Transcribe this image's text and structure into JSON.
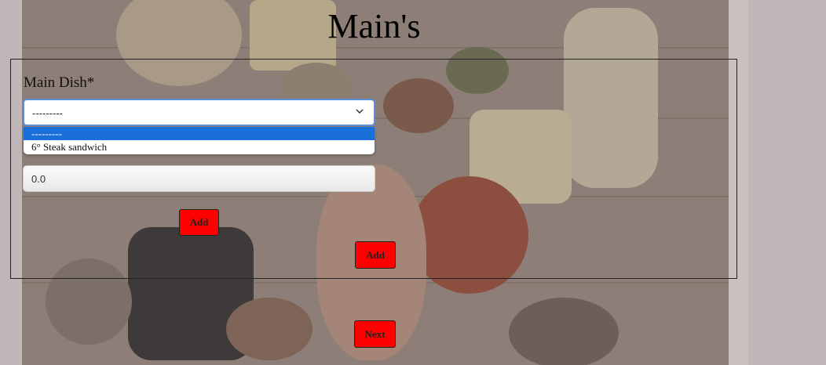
{
  "page": {
    "title": "Main's"
  },
  "form": {
    "main_dish_label": "Main Dish*",
    "main_dish_select": {
      "selected": "---------",
      "options": [
        "---------",
        "6° Steak sandwich"
      ]
    },
    "price_value": "0.0",
    "add_item_button": "Add",
    "add_main_button": "Add"
  },
  "footer": {
    "next_button": "Next"
  },
  "colors": {
    "button_bg": "#ff0000",
    "option_highlight": "#1a6fd8",
    "select_focus_border": "#5a8fd8"
  },
  "icons": {
    "select_chevron": "chevron-down-icon"
  }
}
